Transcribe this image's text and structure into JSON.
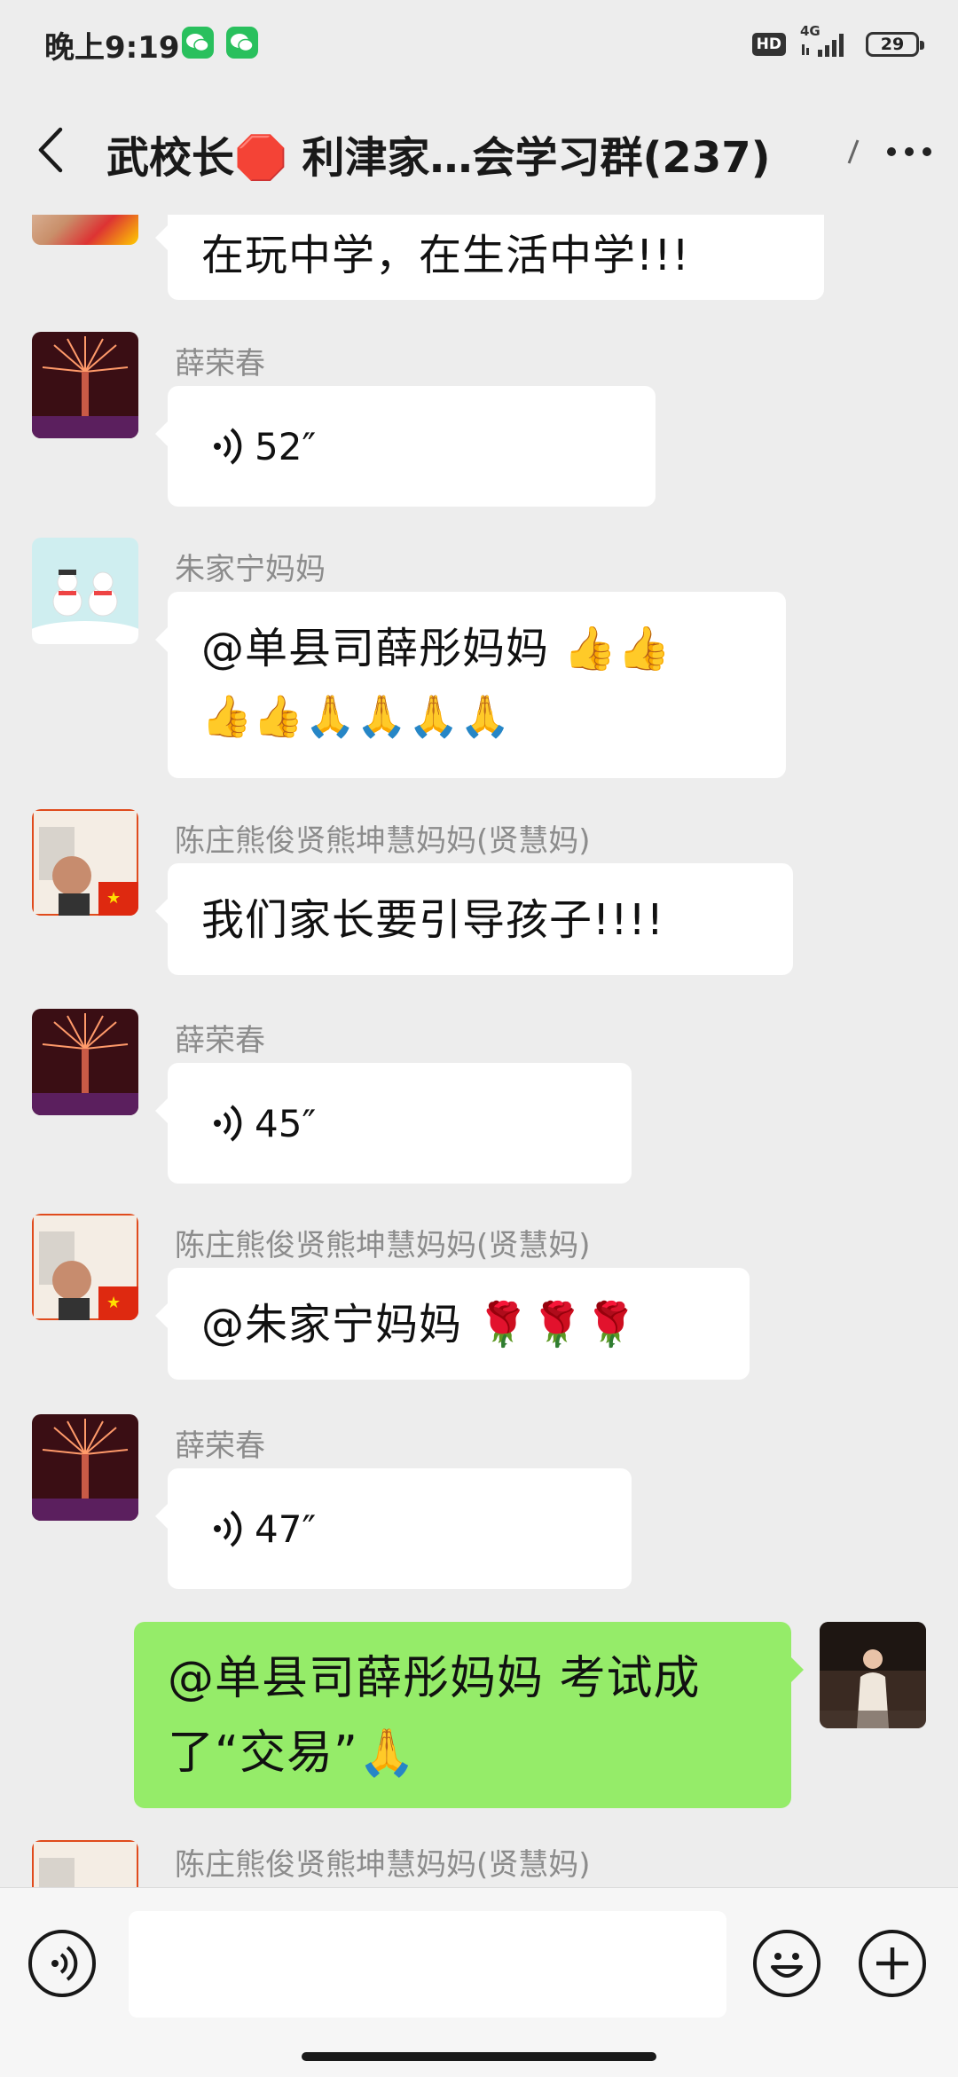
{
  "status_bar": {
    "time": "晚上9:19",
    "hd": "HD",
    "network": "4G",
    "battery": "29"
  },
  "nav": {
    "title": "武校长🛑 利津家…会学习群(237)"
  },
  "messages": [
    {
      "text": "在玩中学，在生活中学!!!"
    },
    {
      "sender": "薛荣春",
      "duration": "52″"
    },
    {
      "sender": "朱家宁妈妈",
      "line1": "@单县司薛彤妈妈 👍👍",
      "line2": "👍👍🙏🙏🙏🙏"
    },
    {
      "sender": "陈庄熊俊贤熊坤慧妈妈(贤慧妈)",
      "text": "我们家长要引导孩子!!!!"
    },
    {
      "sender": "薛荣春",
      "duration": "45″"
    },
    {
      "sender": "陈庄熊俊贤熊坤慧妈妈(贤慧妈)",
      "text": "@朱家宁妈妈 🌹🌹🌹"
    },
    {
      "sender": "薛荣春",
      "duration": "47″"
    },
    {
      "line1": "@单县司薛彤妈妈  考试成",
      "line2": "了“交易”🙏"
    },
    {
      "sender": "陈庄熊俊贤熊坤慧妈妈(贤慧妈)"
    }
  ],
  "input": {
    "placeholder": ""
  },
  "icons": {
    "back": "chevron-left-icon",
    "more": "more-dots-icon",
    "voice": "voice-icon",
    "emoji": "emoji-icon",
    "plus": "plus-icon"
  },
  "colors": {
    "background": "#ededed",
    "bubble_in": "#ffffff",
    "bubble_out": "#95ec69",
    "wechat_green": "#29c05d"
  }
}
